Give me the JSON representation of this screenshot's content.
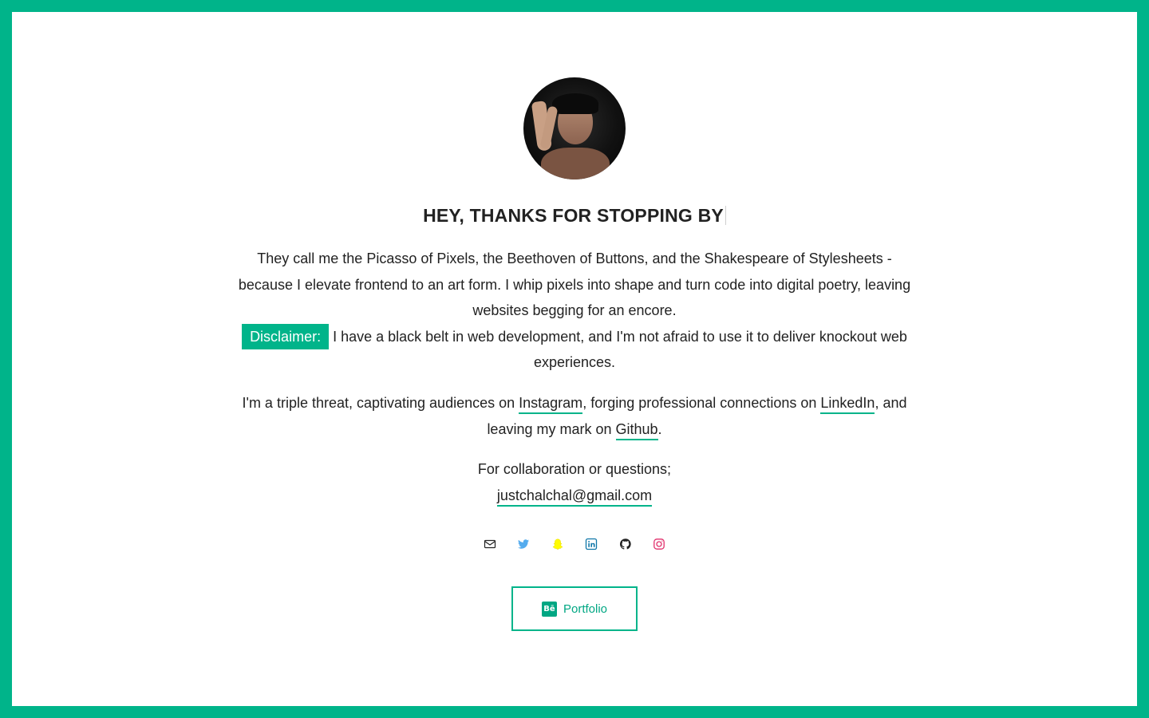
{
  "header": {
    "title": "HEY, THANKS FOR STOPPING BY"
  },
  "intro": {
    "line1": "They call me the Picasso of Pixels, the Beethoven of Buttons, and the Shakespeare of Stylesheets - because I elevate frontend to an art form. I whip pixels into shape and turn code into digital poetry, leaving websites begging for an encore.",
    "disclaimer_label": "Disclaimer:",
    "disclaimer_text": "I have a black belt in web development, and I'm not afraid to use it to deliver knockout web experiences."
  },
  "social_text": {
    "part1": "I'm a triple threat, captivating audiences on ",
    "instagram": "Instagram",
    "part2": ", forging professional connections on ",
    "linkedin": "LinkedIn",
    "part3": ", and leaving my mark on ",
    "github": "Github",
    "part4": "."
  },
  "contact": {
    "label": "For collaboration or questions;",
    "email": "justchalchal@gmail.com"
  },
  "icons": [
    {
      "name": "mail-icon",
      "color": "#222222"
    },
    {
      "name": "twitter-icon",
      "color": "#55acee"
    },
    {
      "name": "snapchat-icon",
      "color": "#fffc00"
    },
    {
      "name": "linkedin-icon",
      "color": "#0e76a8"
    },
    {
      "name": "github-icon",
      "color": "#222222"
    },
    {
      "name": "instagram-icon",
      "color": "#e1306c"
    }
  ],
  "portfolio": {
    "label": "Portfolio",
    "icon_text": "Bē"
  },
  "colors": {
    "accent": "#00b48a",
    "text": "#222222",
    "background": "#ffffff"
  }
}
